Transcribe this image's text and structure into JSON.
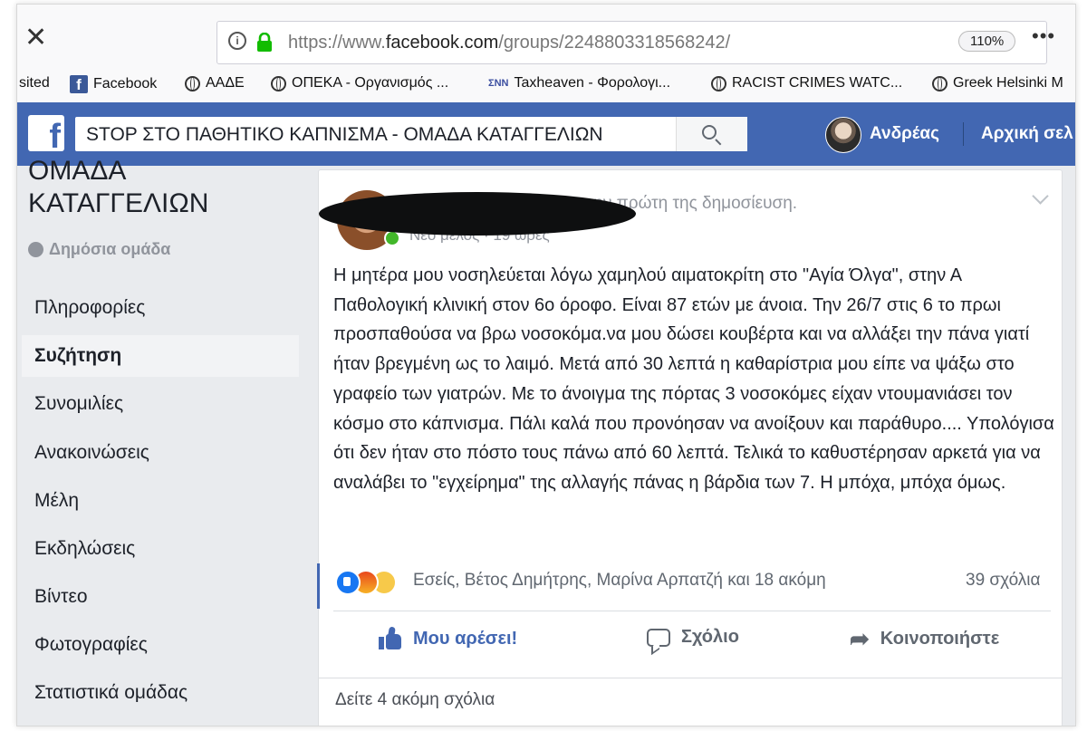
{
  "browser": {
    "close_glyph": "✕",
    "info_glyph": "i",
    "url_prefix": "https://www.",
    "url_domain": "facebook.com",
    "url_path": "/groups/2248803318568242/",
    "zoom": "110%",
    "menu_glyph": "•••"
  },
  "bookmarks": [
    {
      "label": "sited"
    },
    {
      "label": "Facebook"
    },
    {
      "label": "ΑΑΔΕ"
    },
    {
      "label": "ΟΠΕΚΑ - Οργανισμός ..."
    },
    {
      "label": "Taxheaven - Φορολογι..."
    },
    {
      "label": "RACIST CRIMES WATC..."
    },
    {
      "label": "Greek Helsinki M"
    }
  ],
  "fb": {
    "logo": "f",
    "search_value": "STOP ΣΤΟ ΠΑΘΗΤΙΚΟ ΚΑΠΝΙΣΜΑ - ΟΜΑΔΑ ΚΑΤΑΓΓΕΛΙΩΝ",
    "user_name": "Ανδρέας",
    "home_label": "Αρχική σελ"
  },
  "group": {
    "name": "ΟΜΑΔΑ\nΚΑΤΑΓΓΕΛΙΩΝ",
    "privacy": "Δημόσια ομάδα",
    "nav": [
      {
        "label": "Πληροφορίες",
        "active": false
      },
      {
        "label": "Συζήτηση",
        "active": true
      },
      {
        "label": "Συνομιλίες",
        "active": false
      },
      {
        "label": "Ανακοινώσεις",
        "active": false
      },
      {
        "label": "Μέλη",
        "active": false
      },
      {
        "label": "Εκδηλώσεις",
        "active": false
      },
      {
        "label": "Βίντεο",
        "active": false
      },
      {
        "label": "Φωτογραφίες",
        "active": false
      },
      {
        "label": "Στατιστικά ομάδας",
        "active": false
      }
    ]
  },
  "post": {
    "header_text": "οίησε την πρώτη της δημοσίευση.",
    "meta": "Νέο μέλος · 19 ώρες",
    "body": "Η μητέρα μου νοσηλεύεται λόγω χαμηλού αιματοκρίτη στο \"Αγία Όλγα\", στην Α Παθολογική κλινική στον 6ο όροφο. Είναι 87 ετών με άνοια. Την 26/7 στις 6 το πρωι προσπαθούσα να βρω νοσοκόμα.να μου δώσει κουβέρτα και να αλλάξει την πάνα γιατί ήταν βρεγμένη ως το λαιμό. Μετά από 30 λεπτά η καθαρίστρια μου είπε να ψάξω στο γραφείο των γιατρών. Με το άνοιγμα της πόρτας 3 νοσοκόμες είχαν ντουμανιάσει τον κόσμο στο κάπνισμα. Πάλι καλά που προνόησαν να ανοίξουν και παράθυρο.... Υπολόγισα ότι δεν ήταν στο πόστο τους πάνω από 60 λεπτά. Τελικά το καθυστέρησαν αρκετά για να αναλάβει το \"εγχείρημα\" της αλλαγής πάνας η βάρδια των 7. Η μπόχα, μπόχα όμως.",
    "reactions_text": "Εσείς, Βέτος Δημήτρης, Μαρίνα Αρπατζή και 18 ακόμη",
    "comments_count": "39 σχόλια",
    "actions": {
      "like": "Μου αρέσει!",
      "comment": "Σχόλιο",
      "share": "Κοινοποιήστε"
    },
    "more_comments": "Δείτε 4 ακόμη σχόλια"
  },
  "colors": {
    "fb_blue": "#4267b2",
    "online_green": "#42b72a",
    "like_blue": "#4267b2"
  }
}
